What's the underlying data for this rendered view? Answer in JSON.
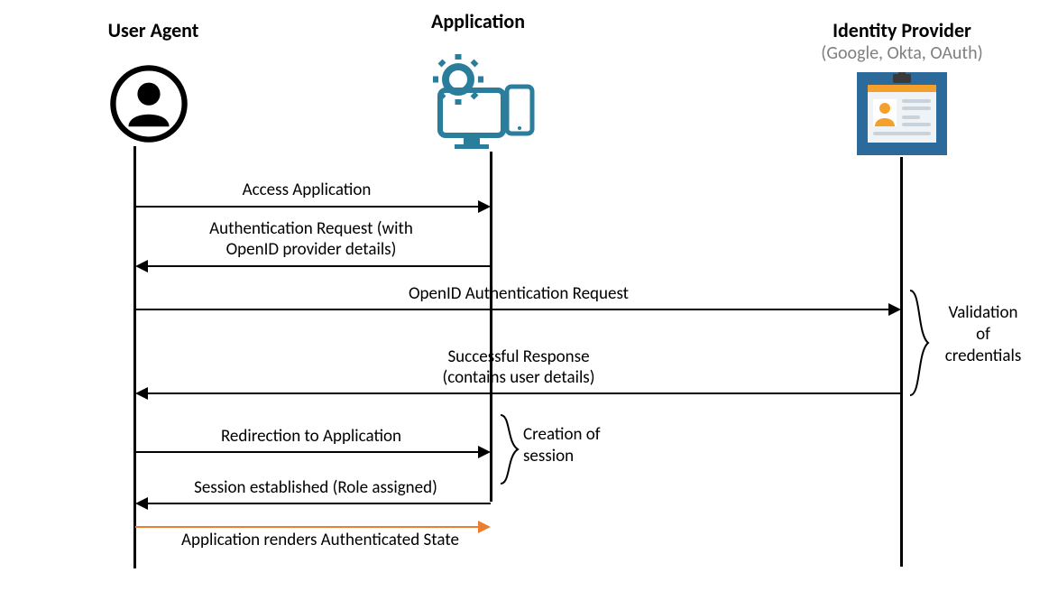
{
  "actors": {
    "user_agent": {
      "title": "User Agent"
    },
    "application": {
      "title": "Application"
    },
    "idp": {
      "title": "Identity Provider",
      "subtitle": "(Google, Okta, OAuth)"
    }
  },
  "messages": {
    "m1": "Access Application",
    "m2_l1": "Authentication Request (with",
    "m2_l2": "OpenID provider details)",
    "m3": "OpenID Authentication Request",
    "m4_l1": "Successful Response",
    "m4_l2": "(contains user details)",
    "m5": "Redirection to Application",
    "m6": "Session established (Role assigned)",
    "m7": "Application renders Authenticated State"
  },
  "side_notes": {
    "validation_l1": "Validation",
    "validation_l2": "of",
    "validation_l3": "credentials",
    "session_l1": "Creation of",
    "session_l2": "session"
  },
  "colors": {
    "orange": "#ed7d31",
    "teal": "#2a7e9b",
    "idp_bg": "#2b6a9b",
    "idp_bar": "#f4a02a"
  }
}
